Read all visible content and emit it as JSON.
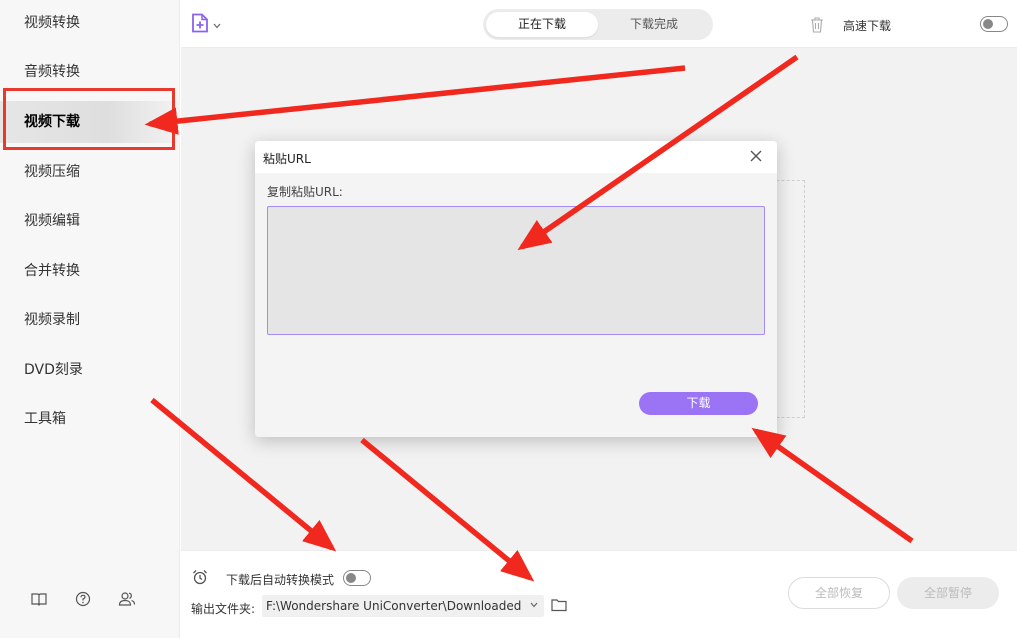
{
  "sidebar": {
    "items": [
      {
        "label": "视频转换",
        "active": false
      },
      {
        "label": "音频转换",
        "active": false
      },
      {
        "label": "视频下载",
        "active": true
      },
      {
        "label": "视频压缩",
        "active": false
      },
      {
        "label": "视频编辑",
        "active": false
      },
      {
        "label": "合并转换",
        "active": false
      },
      {
        "label": "视频录制",
        "active": false
      },
      {
        "label": "DVD刻录",
        "active": false
      },
      {
        "label": "工具箱",
        "active": false
      }
    ],
    "footer_icons": [
      "book-icon",
      "help-icon",
      "users-icon"
    ]
  },
  "topbar": {
    "add_icon": "add-file-icon",
    "tabs": [
      {
        "label": "正在下载",
        "active": true
      },
      {
        "label": "下载完成",
        "active": false
      }
    ],
    "trash_icon": "trash-icon",
    "high_speed_label": "高速下载",
    "high_speed_enabled": false
  },
  "dialog": {
    "title": "粘贴URL",
    "close_icon": "close-icon",
    "field_label": "复制粘贴URL:",
    "url_value": "",
    "download_label": "下载"
  },
  "bottom": {
    "alarm_icon": "alarm-clock-icon",
    "auto_convert_label": "下载后自动转换模式",
    "auto_convert_enabled": false,
    "output_label": "输出文件夹:",
    "output_path": "F:\\Wondershare UniConverter\\Downloaded",
    "folder_icon": "folder-icon",
    "resume_all_label": "全部恢复",
    "pause_all_label": "全部暂停"
  },
  "colors": {
    "accent": "#9a74f5",
    "highlight_red": "#e8392e",
    "arrow_red": "#f0281e"
  }
}
